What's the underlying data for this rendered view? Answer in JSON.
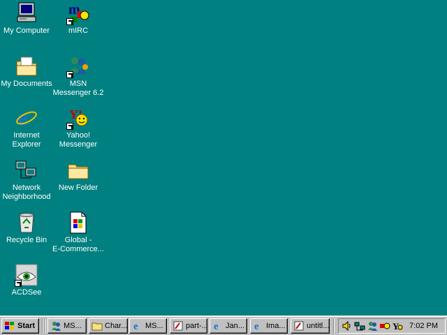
{
  "desktop": {
    "background": "#008080",
    "icons": [
      {
        "label": "My Computer",
        "icon": "my-computer-icon",
        "shortcut": false
      },
      {
        "label": "mIRC",
        "icon": "mirc-icon",
        "shortcut": true
      },
      {
        "label": "My Documents",
        "icon": "my-documents-icon",
        "shortcut": false
      },
      {
        "label": "MSN\nMessenger 6.2",
        "icon": "msn-messenger-icon",
        "shortcut": true
      },
      {
        "label": "Internet\nExplorer",
        "icon": "internet-explorer-icon",
        "shortcut": false
      },
      {
        "label": "Yahoo!\nMessenger",
        "icon": "yahoo-messenger-icon",
        "shortcut": true
      },
      {
        "label": "Network\nNeighborhood",
        "icon": "network-neighborhood-icon",
        "shortcut": false
      },
      {
        "label": "New Folder",
        "icon": "folder-icon",
        "shortcut": false
      },
      {
        "label": "Recycle Bin",
        "icon": "recycle-bin-icon",
        "shortcut": false
      },
      {
        "label": "Global -\nE-Commerce...",
        "icon": "document-icon",
        "shortcut": false
      },
      {
        "label": "ACDSee",
        "icon": "acdsee-icon",
        "shortcut": true
      }
    ]
  },
  "taskbar": {
    "start_label": "Start",
    "buttons": [
      {
        "label": "MS...",
        "icon": "msn-messenger-icon"
      },
      {
        "label": "Char...",
        "icon": "folder-icon"
      },
      {
        "label": "MS...",
        "icon": "internet-explorer-icon"
      },
      {
        "label": "part-...",
        "icon": "paint-icon"
      },
      {
        "label": "Jan...",
        "icon": "internet-explorer-icon"
      },
      {
        "label": "Ima...",
        "icon": "internet-explorer-icon"
      },
      {
        "label": "untitl...",
        "icon": "paint-icon"
      }
    ],
    "tray_icons": [
      "volume-icon",
      "network-icon",
      "msn-tray-icon",
      "mirc-tray-icon",
      "yahoo-tray-icon"
    ],
    "clock": "7:02 PM"
  }
}
